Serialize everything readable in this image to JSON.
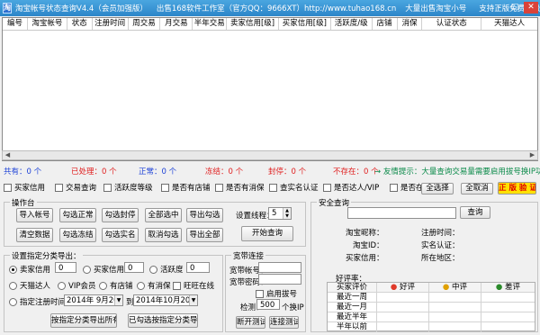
{
  "window": {
    "app_icon": "淘",
    "title": "淘宝帐号状态查询V4.4（会员加强版）",
    "vendor": "出售168软件工作室（官方QQ：9666XT）http://www.tuhao168.cn",
    "extra1": "大量出售淘宝小号",
    "extra2": "支持正版免费升级"
  },
  "grid": {
    "columns": [
      "编号",
      "淘宝帐号",
      "状态",
      "注册时间",
      "周交易",
      "月交易",
      "半年交易",
      "卖家信用[级]",
      "买家信用[级]",
      "活跃度/级",
      "店铺",
      "消保",
      "认证状态",
      "天猫达人"
    ]
  },
  "status": {
    "total_label": "共有：",
    "total_value": "0 个",
    "processed_label": "已处理：",
    "processed_value": "0 个",
    "normal_label": "正常：",
    "normal_value": "0 个",
    "frozen_label": "冻结：",
    "frozen_value": "0 个",
    "banned_label": "封停：",
    "banned_value": "0 个",
    "missing_label": "不存在：",
    "missing_value": "0 个",
    "tip": "→ 友情提示：大量查询交易量需要启用拔号换IP功能"
  },
  "filters": [
    {
      "label": "买家信用",
      "checked": false
    },
    {
      "label": "交易查询",
      "checked": false
    },
    {
      "label": "活跃度等级",
      "checked": false
    },
    {
      "label": "是否有店铺",
      "checked": false
    },
    {
      "label": "是否有消保",
      "checked": false
    },
    {
      "label": "查实名认证",
      "checked": false
    },
    {
      "label": "是否达人/VIP",
      "checked": false
    },
    {
      "label": "是否在线",
      "checked": false
    }
  ],
  "toolbar": {
    "select_all": "全选择",
    "deselect_all": "全取消",
    "genuine": "正 版 验 证"
  },
  "ops": {
    "legend": "操作台",
    "import": "导入帐号",
    "check_normal": "勾选正常",
    "check_banned": "勾选封停",
    "select_all": "全部选中",
    "export_checked": "导出勾选",
    "clear": "清空数据",
    "check_frozen": "勾选冻结",
    "check_realname": "勾选实名",
    "cancel_checked": "取消勾选",
    "export_all": "导出全部",
    "threads_label": "设置线程：",
    "threads_value": "5",
    "start": "开始查询"
  },
  "export": {
    "legend": "设置指定分类导出：",
    "seller": "卖家信用",
    "seller_val": "0",
    "buyer": "买家信用",
    "buyer_val": "0",
    "active": "活跃度",
    "active_val": "0",
    "tmall": "天猫达人",
    "vip": "VIP会员",
    "store": "有店铺",
    "consumer": "有消保",
    "wangwang": "旺旺在线",
    "reg_time": "指定注册时间",
    "date_from": "2014年 9月20日",
    "to": "到",
    "date_to": "2014年10月20日",
    "btn_export_all": "按指定分类导出所有",
    "btn_export_checked": "已勾选按指定分类导出"
  },
  "broadband": {
    "legend": "宽带连接",
    "account": "宽带帐号：",
    "password": "宽带密码：",
    "enable": "启用拔号",
    "detect": "检测：",
    "detect_value": "500",
    "per_ip": "个换IP",
    "disconnect": "断开测试",
    "connect": "连接测试"
  },
  "security": {
    "legend": "安全查询",
    "query": "查询",
    "nick": "淘宝昵称：",
    "id": "淘宝ID：",
    "buyer_credit": "买家信用：",
    "reg_time": "注册时间：",
    "realname": "实名认证：",
    "region": "所在地区：",
    "rate": "好评率：",
    "table_headers": [
      "买家评价",
      "好评",
      "中评",
      "差评"
    ],
    "table_rows": [
      "最近一周",
      "最近一月",
      "最近半年",
      "半年以前"
    ]
  }
}
